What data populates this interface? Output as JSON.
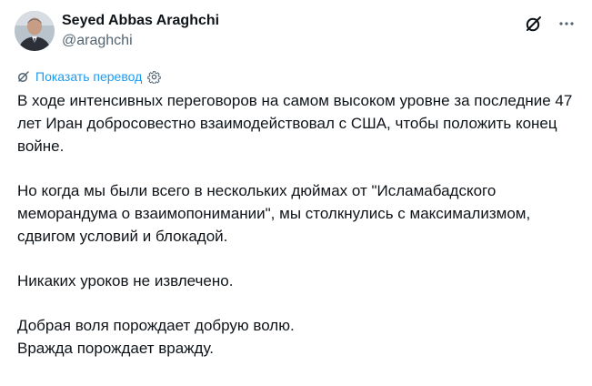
{
  "author": {
    "name": "Seyed Abbas Araghchi",
    "handle": "@araghchi"
  },
  "actions": {
    "grok_icon": "grok-icon",
    "more_icon": "more-icon"
  },
  "translate": {
    "label": "Показать перевод"
  },
  "tweet": {
    "paragraphs": [
      "В ходе интенсивных переговоров на самом высоком уровне за последние 47 лет Иран добросовестно взаимодействовал с США, чтобы положить конец войне.",
      "Но когда мы были всего в нескольких дюймах от \"Исламабадского меморандума о взаимопонимании\", мы столкнулись с максимализмом, сдвигом условий и блокадой.",
      "Никаких уроков не извлечено.",
      "Добрая воля порождает добрую волю.\nВражда порождает вражду."
    ]
  },
  "colors": {
    "text": "#0f1419",
    "secondary": "#536471",
    "link": "#1d9bf0"
  }
}
